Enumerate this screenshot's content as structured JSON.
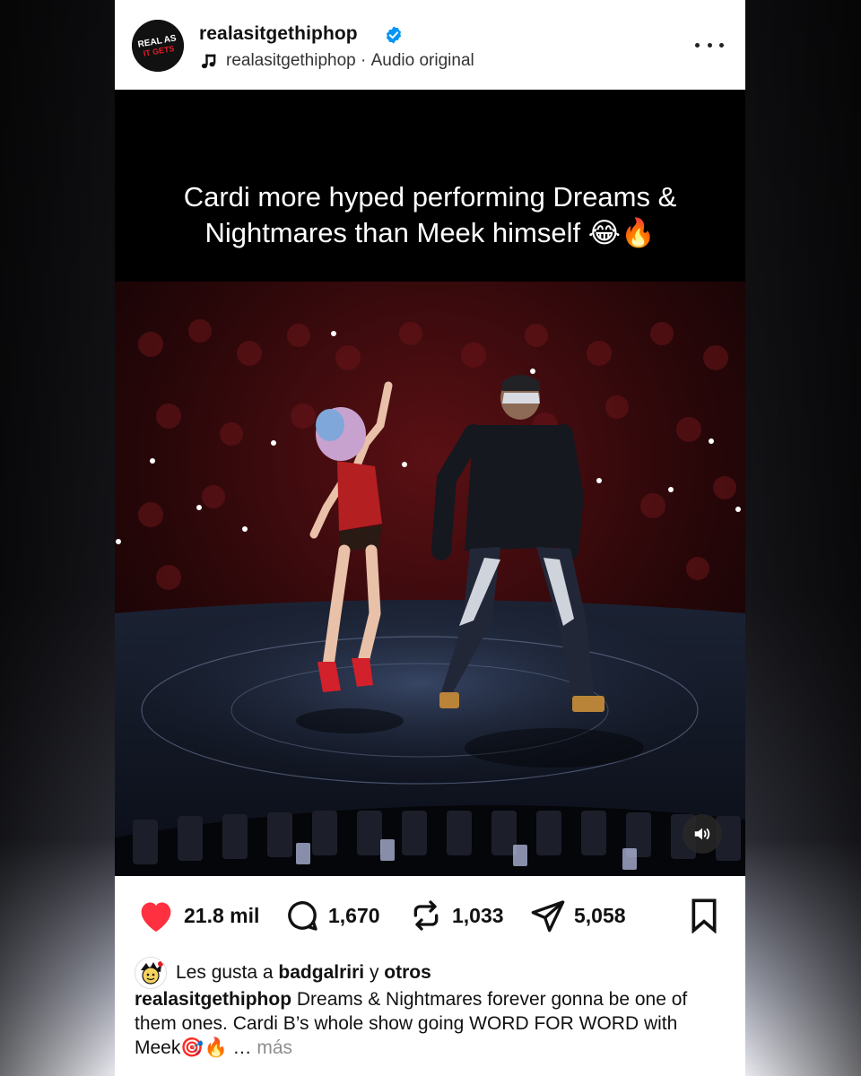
{
  "header": {
    "username": "realasitgethiphop",
    "audio_user": "realasitgethiphop",
    "audio_separator": " · ",
    "audio_label": "Audio original",
    "avatar_text": [
      "REAL AS",
      "IT GETS"
    ]
  },
  "media": {
    "overlay_text": "Cardi more hyped performing Dreams & Nightmares than Meek himself 😂🔥"
  },
  "actions": {
    "likes_count": "21.8 mil",
    "comments_count": "1,670",
    "reposts_count": "1,033",
    "shares_count": "5,058"
  },
  "likes_line": {
    "prefix": "Les gusta a ",
    "user": "badgalriri",
    "conj": " y ",
    "others": "otros"
  },
  "caption": {
    "username": "realasitgethiphop",
    "text": " Dreams & Nightmares forever gonna be one of them ones. Cardi B’s whole show going WORD FOR WORD with Meek🎯🔥 … ",
    "more": "más"
  },
  "colors": {
    "like_red": "#ff3040",
    "verified_blue": "#0095f6"
  }
}
